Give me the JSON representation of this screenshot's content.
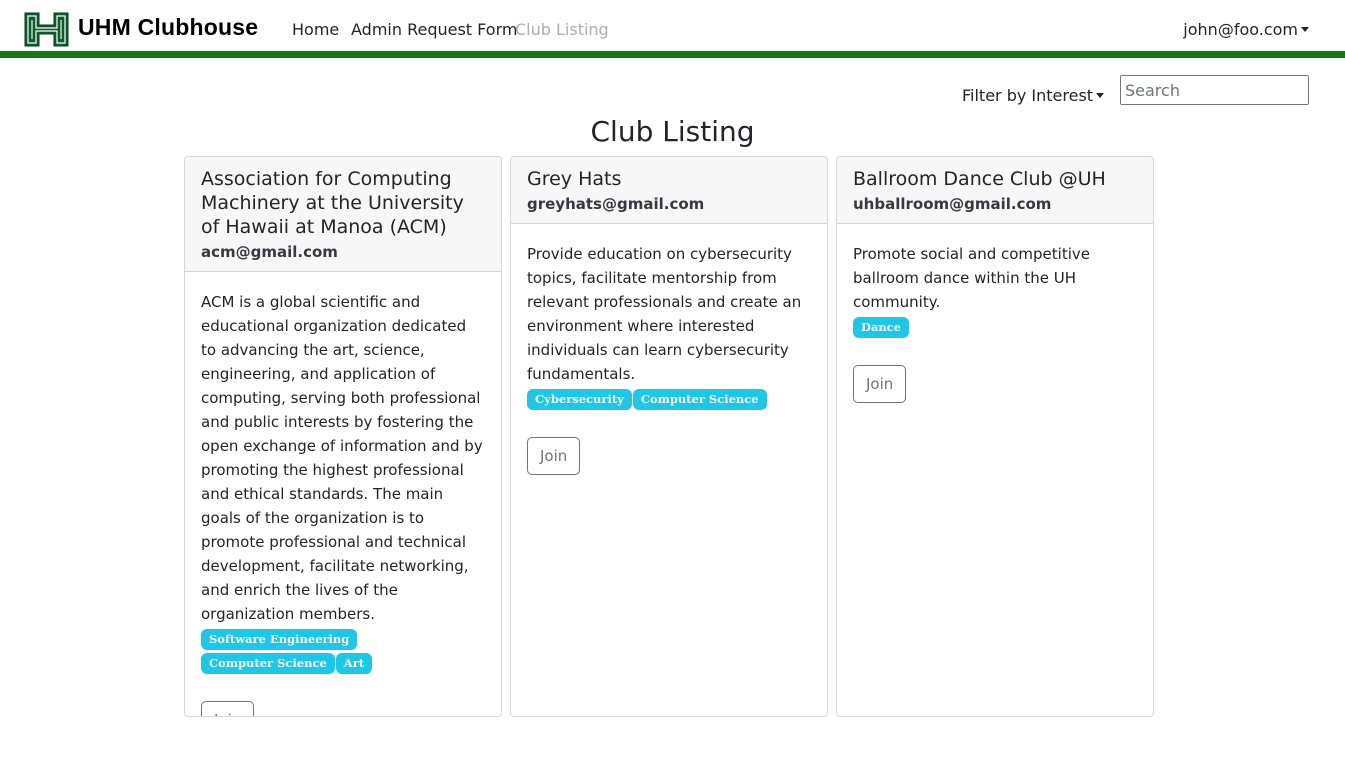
{
  "navbar": {
    "brand": "UHM Clubhouse",
    "logo_icon": "uh-h-logo-icon",
    "links": [
      {
        "label": "Home",
        "active": false
      },
      {
        "label": "Admin Request Form",
        "active": false
      },
      {
        "label": "Club Listing",
        "active": true
      }
    ],
    "user": "john@foo.com",
    "accent_color": "#137a13"
  },
  "toolbar": {
    "filter_label": "Filter by Interest",
    "search_placeholder": "Search"
  },
  "page_title": "Club Listing",
  "clubs": [
    {
      "name": "Association for Computing Machinery at the University of Hawaii at Manoa (ACM)",
      "email": "acm@gmail.com",
      "description": "ACM is a global scientific and educational organization dedicated to advancing the art, science, engineering, and application of computing, serving both professional and public interests by fostering the open exchange of information and by promoting the highest professional and ethical standards. The main goals of the organization is to promote professional and technical development, facilitate networking, and enrich the lives of the organization members.",
      "interests": [
        "Software Engineering",
        "Computer Science",
        "Art"
      ],
      "join_label": "Join"
    },
    {
      "name": "Grey Hats",
      "email": "greyhats@gmail.com",
      "description": "Provide education on cybersecurity topics, facilitate mentorship from relevant professionals and create an environment where interested individuals can learn cybersecurity fundamentals.",
      "interests": [
        "Cybersecurity",
        "Computer Science"
      ],
      "join_label": "Join"
    },
    {
      "name": "Ballroom Dance Club @UH",
      "email": "uhballroom@gmail.com",
      "description": "Promote social and competitive ballroom dance within the UH community.",
      "interests": [
        "Dance"
      ],
      "join_label": "Join"
    }
  ],
  "badge_color": "#1cc7e8"
}
